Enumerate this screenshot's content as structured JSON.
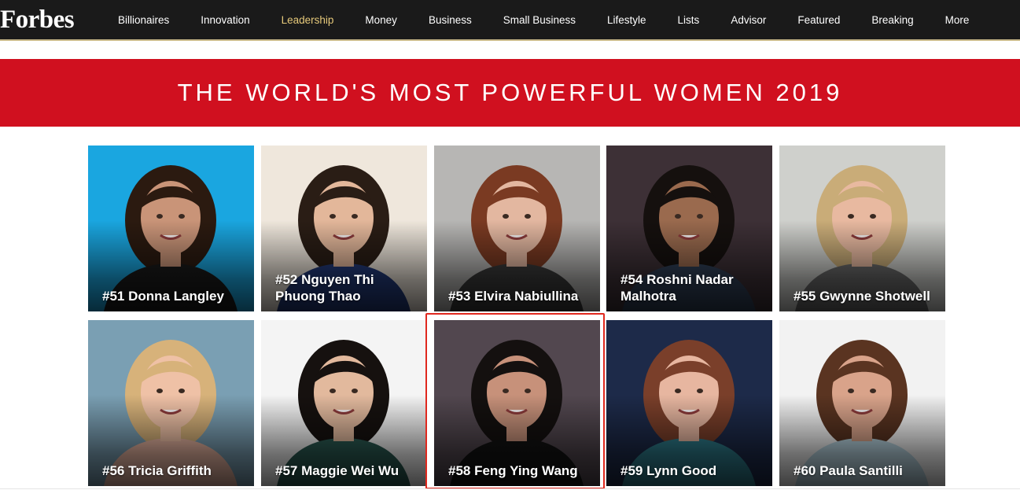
{
  "header": {
    "logo": "Forbes",
    "nav": [
      {
        "label": "Billionaires",
        "active": false
      },
      {
        "label": "Innovation",
        "active": false
      },
      {
        "label": "Leadership",
        "active": true
      },
      {
        "label": "Money",
        "active": false
      },
      {
        "label": "Business",
        "active": false
      },
      {
        "label": "Small Business",
        "active": false
      },
      {
        "label": "Lifestyle",
        "active": false
      },
      {
        "label": "Lists",
        "active": false
      },
      {
        "label": "Advisor",
        "active": false
      },
      {
        "label": "Featured",
        "active": false
      },
      {
        "label": "Breaking",
        "active": false
      },
      {
        "label": "More",
        "active": false
      }
    ]
  },
  "banner": {
    "title": "THE WORLD'S MOST POWERFUL WOMEN 2019",
    "color": "#d0101f"
  },
  "cards": [
    {
      "name": "#51 Donna Langley",
      "bg": "#1aa6e0",
      "hair": "#2b1a10",
      "skin": "#c99478",
      "top": "#1a1a1a"
    },
    {
      "name": "#52 Nguyen Thi Phuong Thao",
      "bg": "#efe7dc",
      "hair": "#2a1d15",
      "skin": "#e3b79a",
      "top": "#233a7a"
    },
    {
      "name": "#53 Elvira Nabiullina",
      "bg": "#b7b6b4",
      "hair": "#7a3a22",
      "skin": "#e3b7a0",
      "top": "#3a3a3a"
    },
    {
      "name": "#54 Roshni Nadar Malhotra",
      "bg": "#3d3036",
      "hair": "#15100e",
      "skin": "#9a6a4e",
      "top": "#2f3f56"
    },
    {
      "name": "#55 Gwynne Shotwell",
      "bg": "#cfd0cc",
      "hair": "#c9ac78",
      "skin": "#e8b9a0",
      "top": "#6a6a6a"
    },
    {
      "name": "#56 Tricia Griffith",
      "bg": "#7a9fb3",
      "hair": "#d7b27a",
      "skin": "#efc1a6",
      "top": "#e6b3a0"
    },
    {
      "name": "#57 Maggie Wei Wu",
      "bg": "#f4f4f4",
      "hair": "#16110f",
      "skin": "#e2b99d",
      "top": "#2a5a52"
    },
    {
      "name": "#58 Feng Ying Wang",
      "bg": "#52474f",
      "hair": "#14100f",
      "skin": "#c7917a",
      "top": "#121212"
    },
    {
      "name": "#59 Lynn Good",
      "bg": "#1d2a49",
      "hair": "#7a3f2a",
      "skin": "#e7b6a0",
      "top": "#2d7a8a"
    },
    {
      "name": "#60 Paula Santilli",
      "bg": "#f2f2f2",
      "hair": "#5a3421",
      "skin": "#d9a38a",
      "top": "#b8d4e0"
    }
  ],
  "selected_card": "#58 Feng Ying Wang"
}
